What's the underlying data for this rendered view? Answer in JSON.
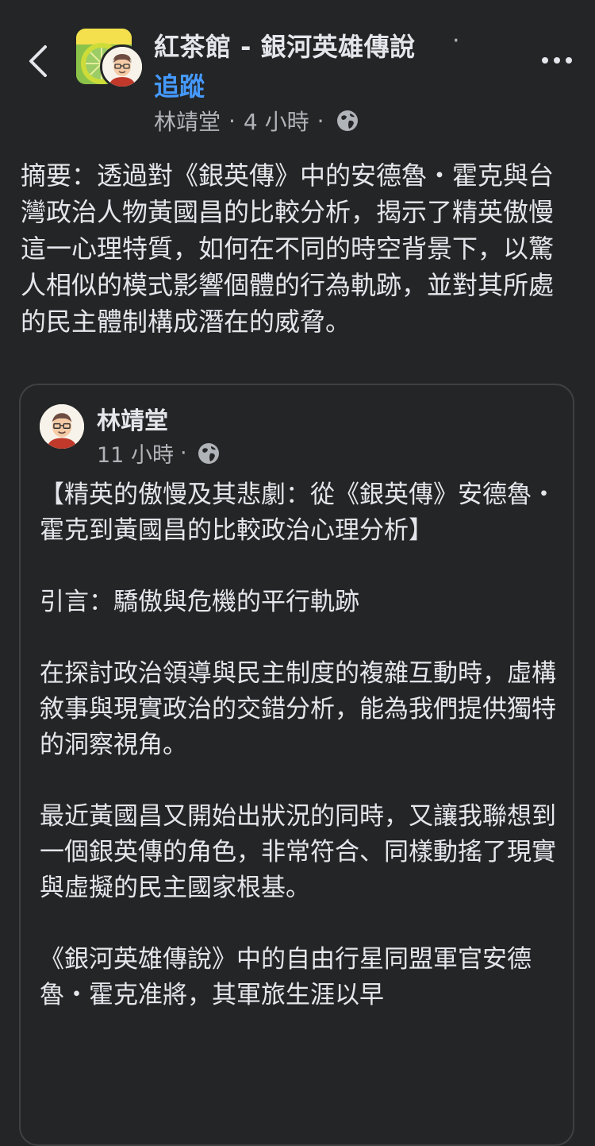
{
  "header": {
    "group_title": "紅茶館 - 銀河英雄傳說",
    "title_dot": "·",
    "follow_label": "追蹤",
    "author": "林靖堂",
    "dot1": "·",
    "time": "4 小時",
    "dot2": "·",
    "privacy_icon": "globe-icon",
    "back_icon": "chevron-left-icon",
    "more_icon": "more-dots-icon"
  },
  "post": {
    "summary": "摘要：透過對《銀英傳》中的安德魯・霍克與台灣政治人物黃國昌的比較分析，揭示了精英傲慢這一心理特質，如何在不同的時空背景下，以驚人相似的模式影響個體的行為軌跡，並對其所處的民主體制構成潛在的威脅。"
  },
  "shared": {
    "author": "林靖堂",
    "time": "11 小時",
    "dot": "·",
    "privacy_icon": "globe-icon",
    "paragraphs": [
      "【精英的傲慢及其悲劇：從《銀英傳》安德魯・霍克到黃國昌的比較政治心理分析】",
      "引言：驕傲與危機的平行軌跡",
      "在探討政治領導與民主制度的複雜互動時，虛構敘事與現實政治的交錯分析，能為我們提供獨特的洞察視角。",
      "最近黃國昌又開始出狀況的同時，又讓我聯想到一個銀英傳的角色，非常符合、同樣動搖了現實與虛擬的民主國家根基。",
      "《銀河英雄傳說》中的自由行星同盟軍官安德魯・霍克准將，其軍旅生涯以早"
    ]
  },
  "colors": {
    "background": "#242526",
    "text": "#e4e6eb",
    "secondary_text": "#b0b3b8",
    "link": "#4599ff",
    "card_border": "#3e4042"
  }
}
